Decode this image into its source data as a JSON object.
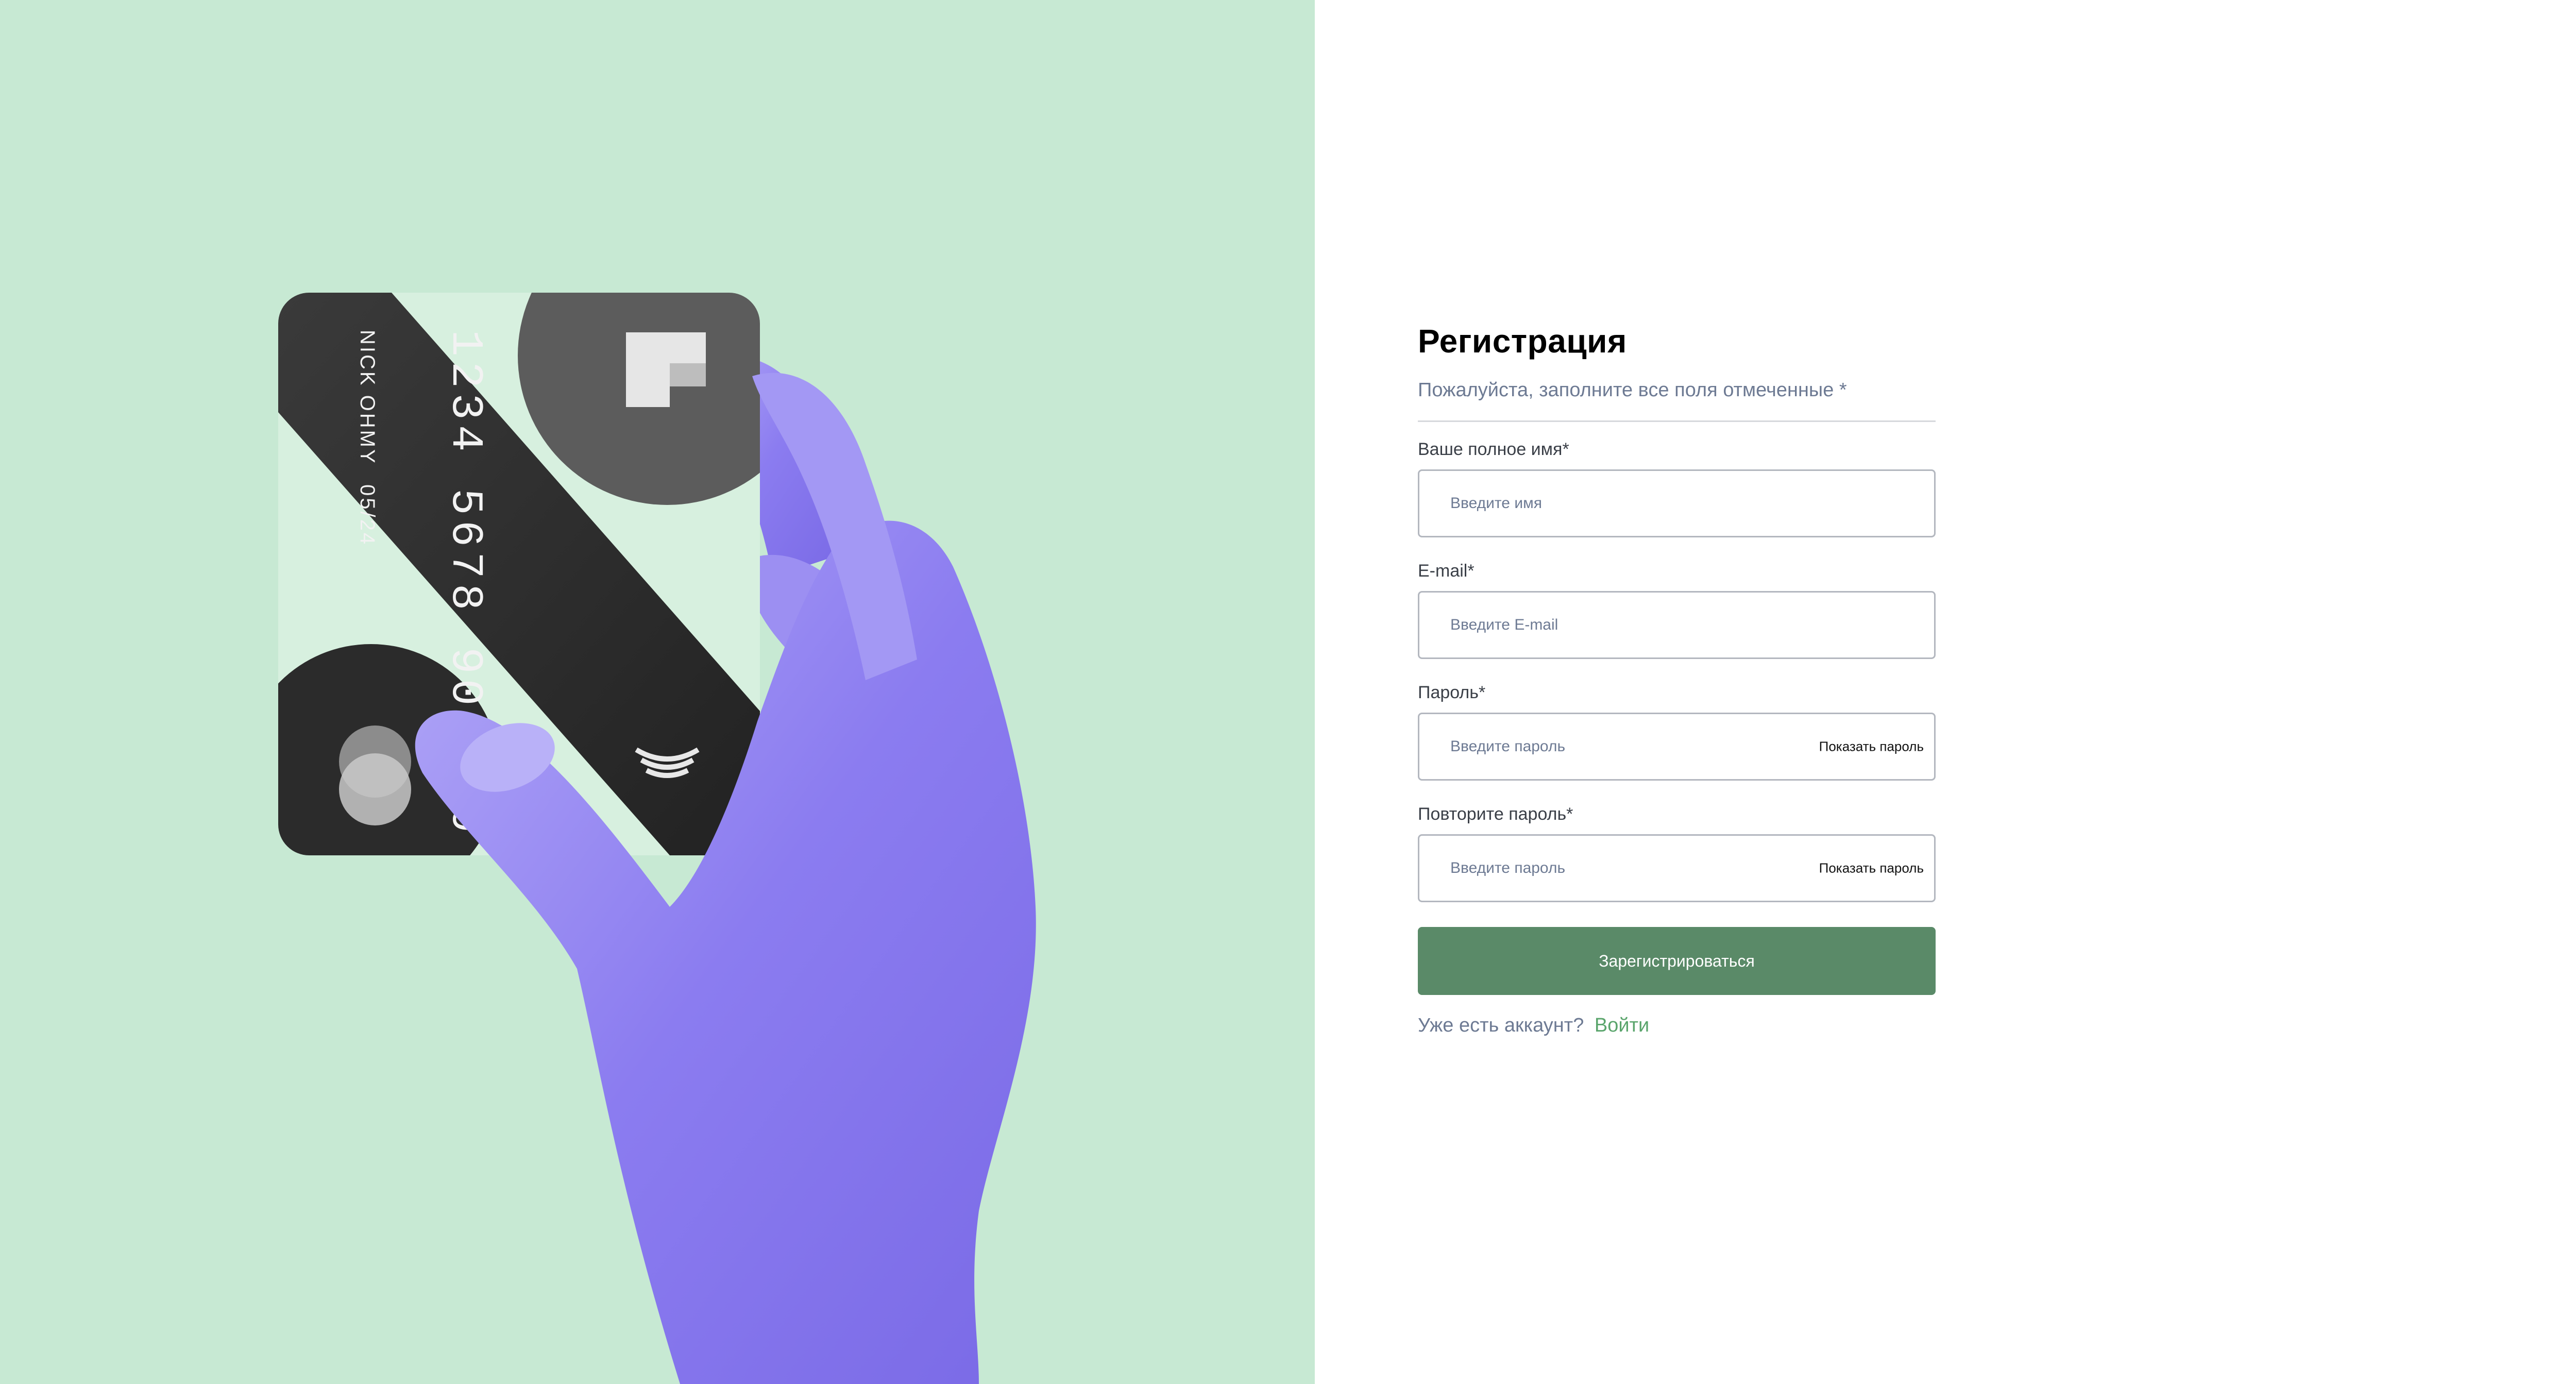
{
  "colors": {
    "hero_background": "#c7e9d3",
    "accent_button": "#5a8a68",
    "link": "#5aa56c",
    "hand": "#8b7cf0"
  },
  "illustration": {
    "card": {
      "number": "1234 5678 9000 0",
      "holder": "NICK OHMY",
      "expiry": "05/24"
    }
  },
  "form": {
    "title": "Регистрация",
    "subtitle": "Пожалуйста, заполните все поля отмеченные *",
    "fields": [
      {
        "label": "Ваше полное имя*",
        "placeholder": "Введите имя",
        "value": ""
      },
      {
        "label": "E-mail*",
        "placeholder": "Введите E-mail",
        "value": ""
      },
      {
        "label": "Пароль*",
        "placeholder": "Введите пароль",
        "value": "",
        "toggle": "Показать пароль"
      },
      {
        "label": "Повторите пароль*",
        "placeholder": "Введите пароль",
        "value": "",
        "toggle": "Показать пароль"
      }
    ],
    "submit_label": "Зарегистрироваться",
    "login_prompt": "Уже есть аккаунт?",
    "login_link": "Войти"
  }
}
